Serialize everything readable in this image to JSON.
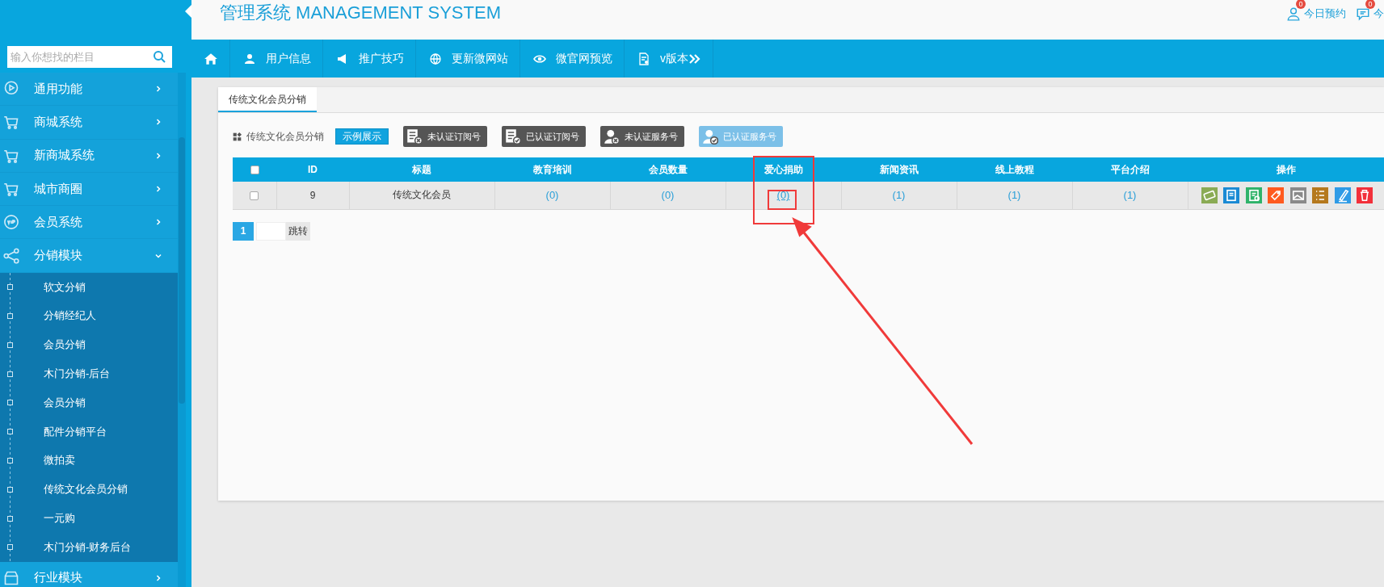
{
  "sidebar": {
    "search": {
      "placeholder": "输入你想找的栏目"
    },
    "menu": [
      {
        "label": "通用功能",
        "kind": "play",
        "expanded": false
      },
      {
        "label": "商城系统",
        "kind": "cart",
        "expanded": false
      },
      {
        "label": "新商城系统",
        "kind": "cart",
        "expanded": false
      },
      {
        "label": "城市商圈",
        "kind": "cart",
        "expanded": false
      },
      {
        "label": "会员系统",
        "kind": "vip",
        "expanded": false
      },
      {
        "label": "分销模块",
        "kind": "share",
        "expanded": true,
        "children": [
          {
            "label": "软文分销"
          },
          {
            "label": "分销经纪人"
          },
          {
            "label": "会员分销"
          },
          {
            "label": "木门分销-后台"
          },
          {
            "label": "会员分销"
          },
          {
            "label": "配件分销平台"
          },
          {
            "label": "微拍卖"
          },
          {
            "label": "传统文化会员分销"
          },
          {
            "label": "一元购"
          },
          {
            "label": "木门分销-财务后台"
          }
        ]
      },
      {
        "label": "行业模块",
        "kind": "store",
        "expanded": false
      }
    ]
  },
  "header": {
    "title": "管理系统 MANAGEMENT SYSTEM",
    "notices": [
      {
        "label": "今日预约",
        "badge": "0",
        "kind": "user"
      },
      {
        "label": "今",
        "badge": "0",
        "kind": "chat"
      }
    ]
  },
  "nav": [
    {
      "kind": "home"
    },
    {
      "label": "用户信息",
      "kind": "user"
    },
    {
      "label": "推广技巧",
      "kind": "megaphone"
    },
    {
      "label": "更新微网站",
      "kind": "globe"
    },
    {
      "label": "微官网预览",
      "kind": "eye"
    },
    {
      "label": "v版本",
      "kind": "version"
    }
  ],
  "tabs": [
    {
      "label": "传统文化会员分销",
      "selected": true
    }
  ],
  "toolbar": {
    "title": "传统文化会员分销",
    "demo_button": "示例展示",
    "filters": [
      {
        "label": "未认证订阅号",
        "kind": "doc-x",
        "selected": false
      },
      {
        "label": "已认证订阅号",
        "kind": "doc-check",
        "selected": false
      },
      {
        "label": "未认证服务号",
        "kind": "person-x",
        "selected": false
      },
      {
        "label": "已认证服务号",
        "kind": "person-check",
        "selected": true
      }
    ]
  },
  "table": {
    "select_all": {
      "checked": false
    },
    "columns": [
      "ID",
      "标题",
      "教育培训",
      "会员数量",
      "爱心捐助",
      "新闻资讯",
      "线上教程",
      "平台介绍",
      "操作"
    ],
    "rows": [
      {
        "checked": false,
        "cells": [
          {
            "text": "9",
            "kind": "text"
          },
          {
            "text": "传统文化会员",
            "kind": "text"
          },
          {
            "text": "(0)",
            "kind": "link"
          },
          {
            "text": "(0)",
            "kind": "link"
          },
          {
            "text": "(0)",
            "kind": "underlined-link"
          },
          {
            "text": "(1)",
            "kind": "link"
          },
          {
            "text": "(1)",
            "kind": "link"
          },
          {
            "text": "(1)",
            "kind": "link"
          }
        ],
        "actions": [
          {
            "kind": "ticket",
            "color": "#8aab55"
          },
          {
            "kind": "note",
            "color": "#1a8ad4"
          },
          {
            "kind": "sheet",
            "color": "#2fb36a"
          },
          {
            "kind": "tag",
            "color": "#ff5a1f"
          },
          {
            "kind": "image",
            "color": "#8a8a8a"
          },
          {
            "kind": "list",
            "color": "#b5791e"
          },
          {
            "kind": "pen",
            "color": "#2f9be6"
          },
          {
            "kind": "trash",
            "color": "#f2303a"
          }
        ]
      }
    ]
  },
  "pagination": {
    "pages": [
      {
        "label": "1",
        "selected": true
      }
    ],
    "jump": "跳转"
  }
}
